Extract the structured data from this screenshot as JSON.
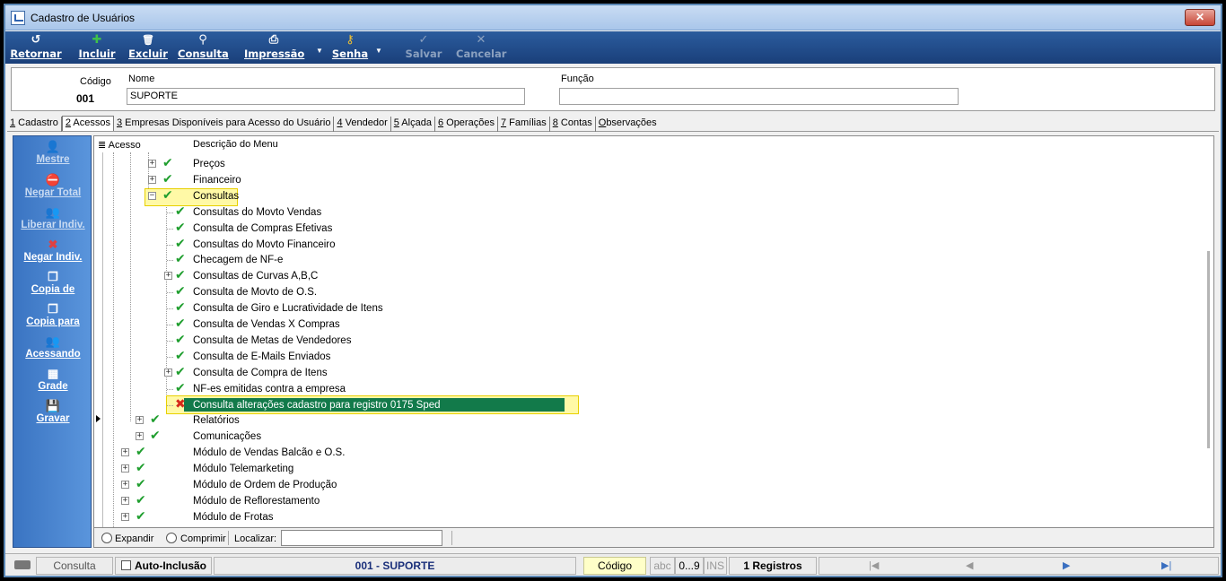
{
  "window": {
    "title": "Cadastro de Usuários",
    "close_label": "✕"
  },
  "toolbar": {
    "buttons": [
      {
        "label": "Retornar",
        "icon": "↺"
      },
      {
        "label": "Incluir",
        "icon": "✚"
      },
      {
        "label": "Excluir",
        "icon": "🗑"
      },
      {
        "label": "Consulta",
        "icon": "⚲"
      },
      {
        "label": "Impressão",
        "icon": "⎙"
      },
      {
        "label": "Senha",
        "icon": "⚷"
      },
      {
        "label": "Salvar",
        "icon": "✓"
      },
      {
        "label": "Cancelar",
        "icon": "✕"
      }
    ],
    "dropdown_arrow": "▼"
  },
  "fields": {
    "codigo_label": "Código",
    "codigo_value": "001",
    "nome_label": "Nome",
    "nome_value": "SUPORTE",
    "funcao_label": "Função",
    "funcao_value": ""
  },
  "tabs": [
    {
      "key": "1",
      "label": " Cadastro"
    },
    {
      "key": "2",
      "label": " Acessos"
    },
    {
      "key": "3",
      "label": " Empresas Disponíveis para Acesso do Usuário"
    },
    {
      "key": "4",
      "label": " Vendedor"
    },
    {
      "key": "5",
      "label": " Alçada"
    },
    {
      "key": "6",
      "label": " Operações"
    },
    {
      "key": "7",
      "label": " Famílias"
    },
    {
      "key": "8",
      "label": " Contas"
    },
    {
      "key": "O",
      "label": "bservações"
    }
  ],
  "leftmenu": [
    {
      "label": "Mestre",
      "icon": "👤"
    },
    {
      "label": "Negar Total",
      "icon": "⛔"
    },
    {
      "label": "Liberar Indiv.",
      "icon": "👥"
    },
    {
      "label": "Negar Indiv.",
      "icon": "✖"
    },
    {
      "label": "Copia de",
      "icon": "❐"
    },
    {
      "label": "Copia para",
      "icon": "❐"
    },
    {
      "label": "Acessando",
      "icon": "👥"
    },
    {
      "label": "Grade",
      "icon": "▦"
    },
    {
      "label": "Gravar",
      "icon": "💾"
    }
  ],
  "grid": {
    "col_acesso": "Acesso",
    "col_descricao": "Descrição do Menu",
    "rows": [
      {
        "text": "Preços"
      },
      {
        "text": "Financeiro"
      },
      {
        "text": "Consultas"
      },
      {
        "text": "Consultas do Movto Vendas"
      },
      {
        "text": "Consulta de Compras Efetivas"
      },
      {
        "text": "Consultas do Movto Financeiro"
      },
      {
        "text": "Checagem de NF-e"
      },
      {
        "text": "Consultas de Curvas A,B,C"
      },
      {
        "text": "Consulta de Movto de O.S."
      },
      {
        "text": "Consulta de Giro e Lucratividade de Itens"
      },
      {
        "text": "Consulta de Vendas X Compras"
      },
      {
        "text": "Consulta de Metas de Vendedores"
      },
      {
        "text": "Consulta de E-Mails Enviados"
      },
      {
        "text": "Consulta de Compra de Itens"
      },
      {
        "text": "NF-es emitidas contra a empresa"
      },
      {
        "text": "Consulta alterações cadastro para registro 0175 Sped"
      },
      {
        "text": "Relatórios"
      },
      {
        "text": "Comunicações"
      },
      {
        "text": "Módulo de Vendas Balcão e O.S."
      },
      {
        "text": "Módulo Telemarketing"
      },
      {
        "text": "Módulo de Ordem de Produção"
      },
      {
        "text": "Módulo de Reflorestamento"
      },
      {
        "text": "Módulo de Frotas"
      }
    ]
  },
  "filterbar": {
    "expandir": "Expandir",
    "comprimir": "Comprimir",
    "localizar": "Localizar:"
  },
  "statusbar": {
    "mode": "Consulta",
    "auto_inclusao": "Auto-Inclusão",
    "record": "001 - SUPORTE",
    "field": "Código",
    "abc": "abc",
    "num": "0...9",
    "ins": "INS",
    "count": "1 Registros",
    "nav_first": "|◀",
    "nav_prev": "◀",
    "nav_next": "▶",
    "nav_last": "▶|"
  }
}
